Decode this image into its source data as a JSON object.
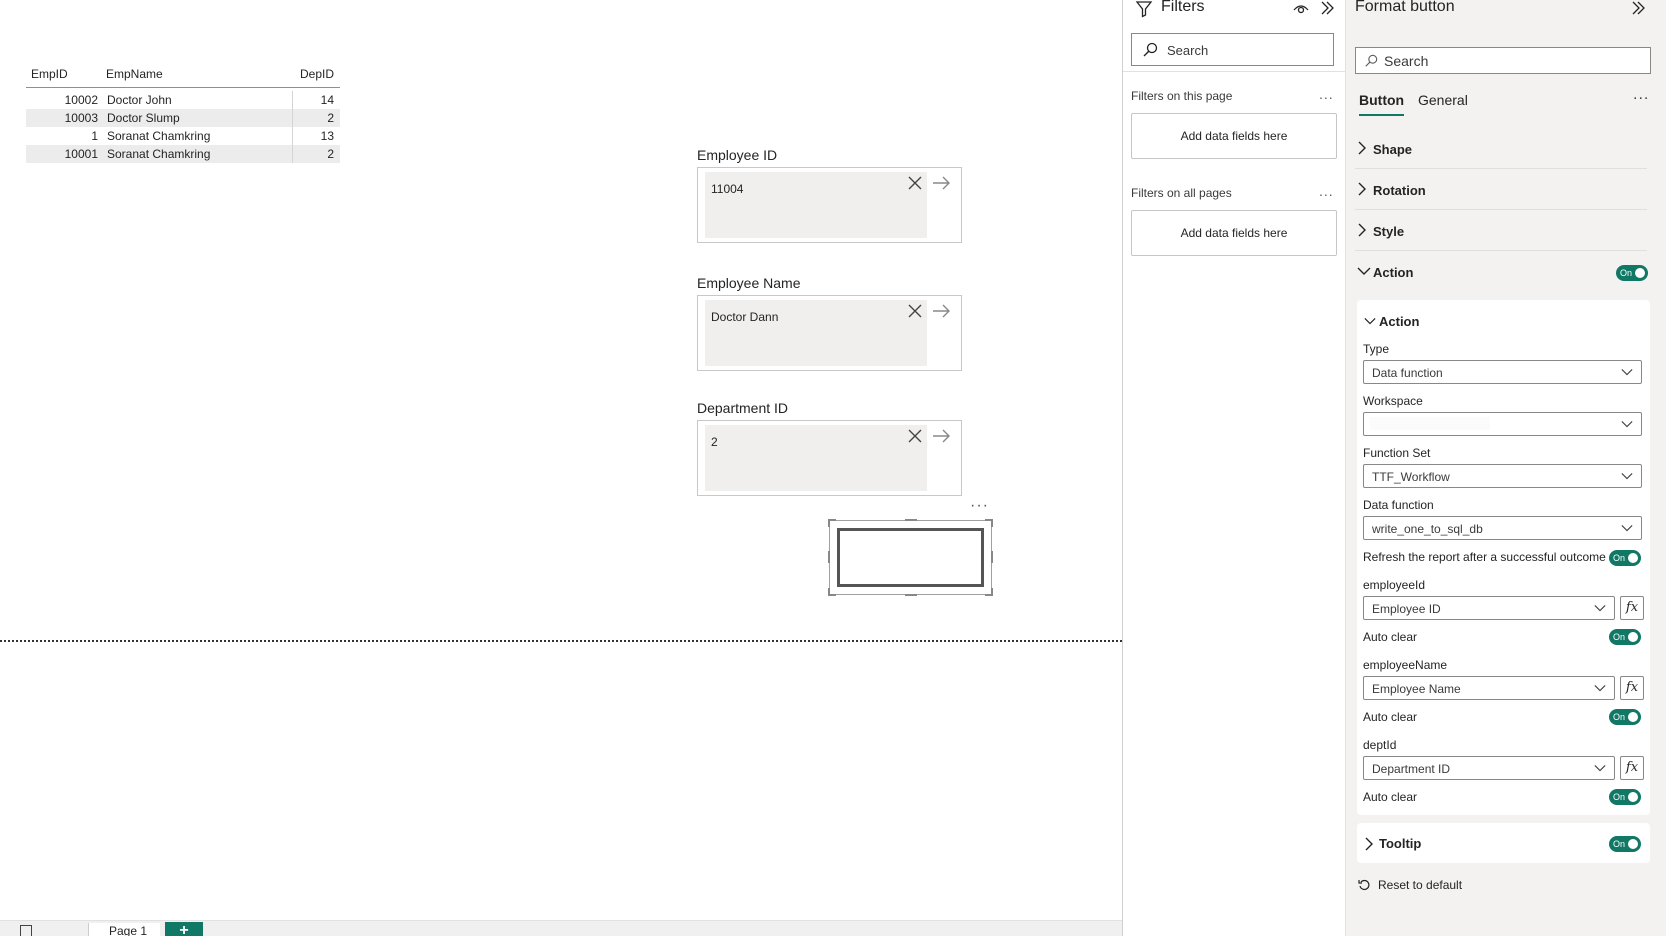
{
  "table": {
    "headers": {
      "empid": "EmpID",
      "empname": "EmpName",
      "depid": "DepID"
    },
    "rows": [
      {
        "empid": "10002",
        "empname": "Doctor John",
        "depid": "14"
      },
      {
        "empid": "10003",
        "empname": "Doctor Slump",
        "depid": "2"
      },
      {
        "empid": "1",
        "empname": "Soranat Chamkring",
        "depid": "13"
      },
      {
        "empid": "10001",
        "empname": "Soranat Chamkring",
        "depid": "2"
      }
    ]
  },
  "slicers": [
    {
      "label": "Employee ID",
      "value": "11004"
    },
    {
      "label": "Employee Name",
      "value": "Doctor Dann"
    },
    {
      "label": "Department ID",
      "value": "2"
    }
  ],
  "bottom": {
    "page_tab": "Page 1",
    "add_page": "+"
  },
  "filters": {
    "title": "Filters",
    "search_placeholder": "Search",
    "on_this_page": "Filters on this page",
    "on_all_pages": "Filters on all pages",
    "add_fields": "Add data fields here",
    "more": "..."
  },
  "format": {
    "title": "Format button",
    "search_placeholder": "Search",
    "tabs": {
      "button": "Button",
      "general": "General",
      "more": "..."
    },
    "sections": {
      "shape": "Shape",
      "rotation": "Rotation",
      "style": "Style",
      "action": "Action",
      "tooltip": "Tooltip"
    },
    "toggle_on": "On",
    "action_card": {
      "title": "Action",
      "type_label": "Type",
      "type_value": "Data function",
      "workspace_label": "Workspace",
      "workspace_value": "",
      "function_set_label": "Function Set",
      "function_set_value": "TTF_Workflow",
      "data_function_label": "Data function",
      "data_function_value": "write_one_to_sql_db",
      "refresh_label": "Refresh the report after a successful outcome",
      "param1_label": "employeeId",
      "param1_value": "Employee ID",
      "param2_label": "employeeName",
      "param2_value": "Employee Name",
      "param3_label": "deptId",
      "param3_value": "Department ID",
      "auto_clear": "Auto clear",
      "fx": "fx"
    },
    "reset": "Reset to default"
  }
}
